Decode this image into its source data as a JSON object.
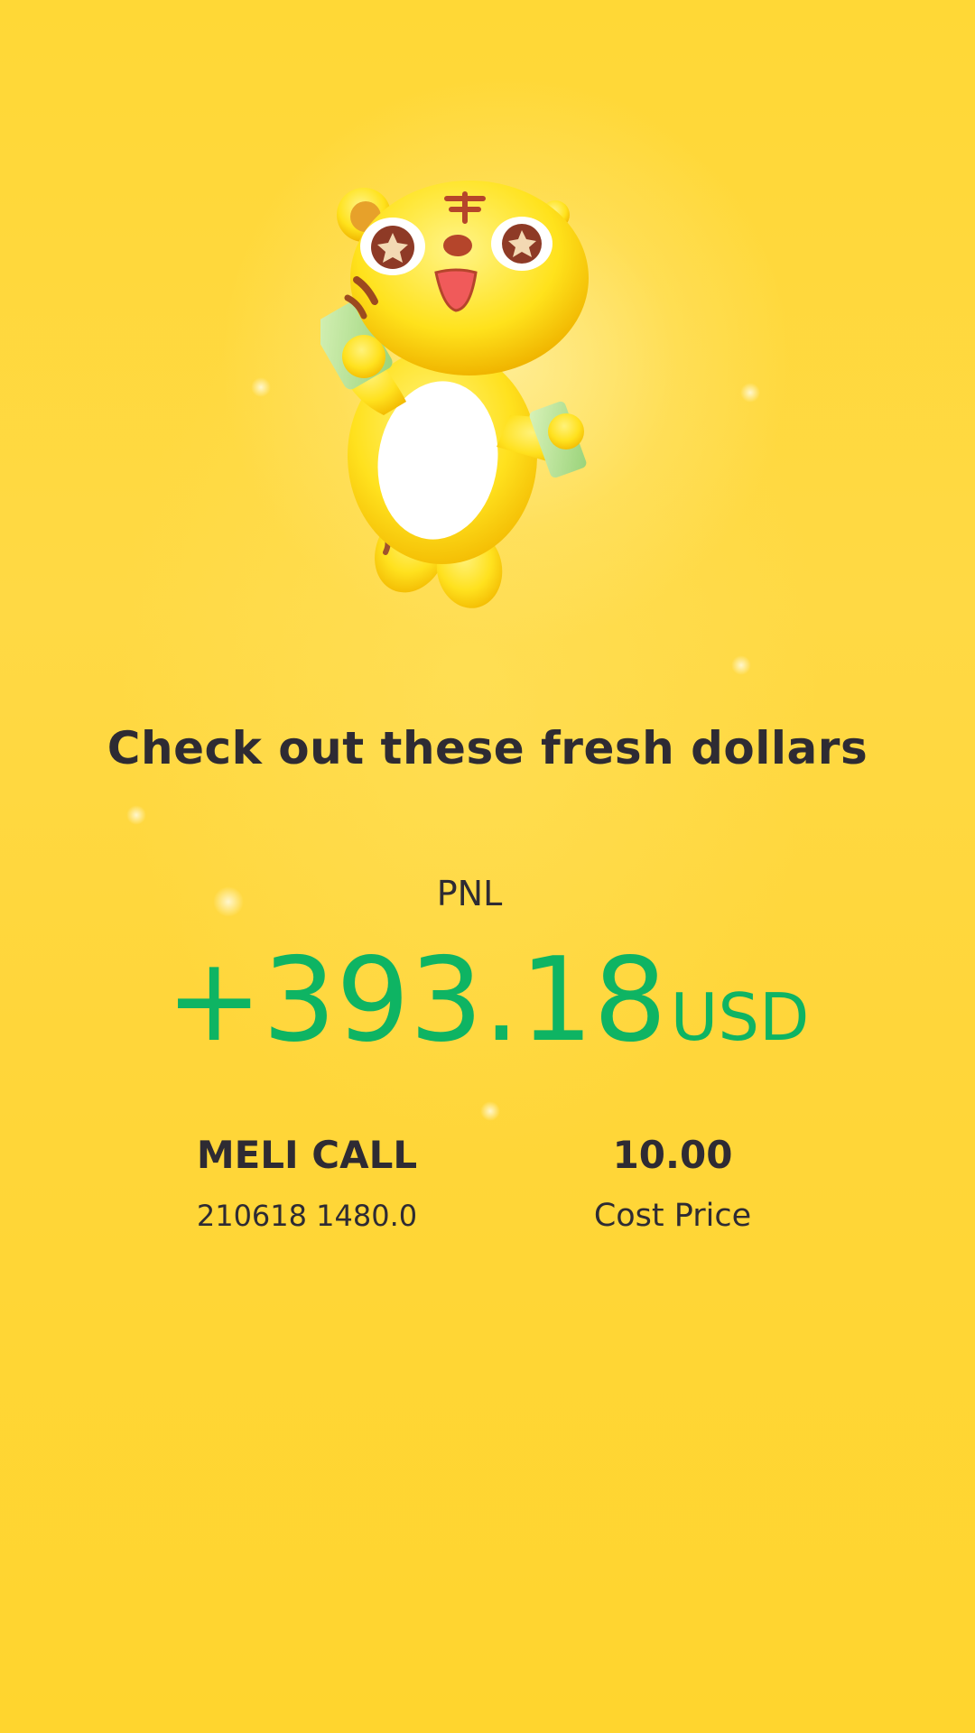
{
  "mascot": {
    "icon": "tiger-mascot-holding-cash-icon"
  },
  "headline": "Check out these fresh dollars",
  "pnl": {
    "label": "PNL",
    "amount": "+393.18",
    "currency": "USD",
    "color": "#0EB463"
  },
  "position": {
    "name": "MELI CALL",
    "detail": "210618 1480.0"
  },
  "cost": {
    "value": "10.00",
    "label": "Cost Price"
  },
  "colors": {
    "background": "#FFD52E",
    "text": "#2E2B33"
  }
}
